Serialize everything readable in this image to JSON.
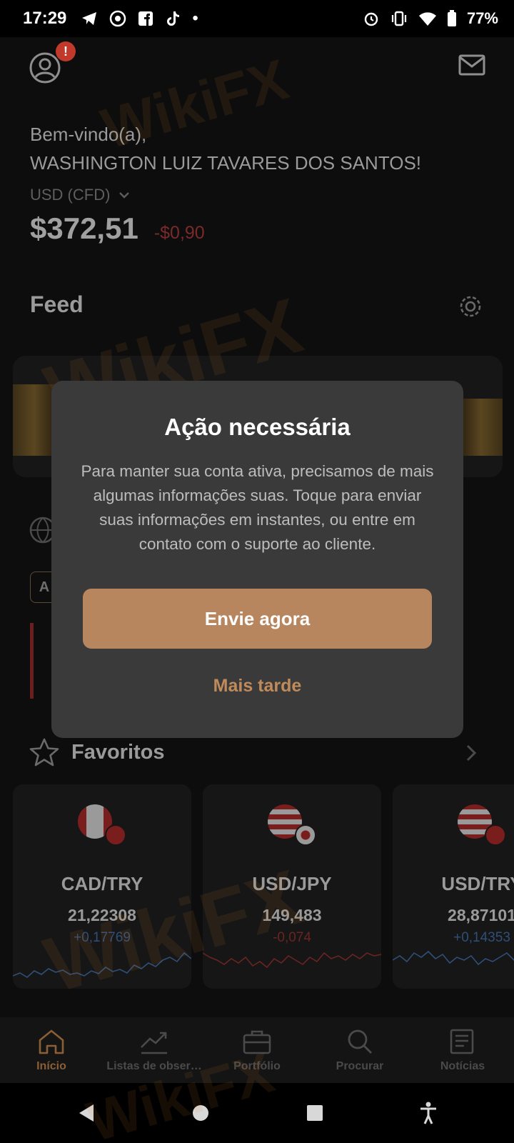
{
  "status_bar": {
    "time": "17:29",
    "battery": "77%"
  },
  "header": {
    "alert_badge": "!",
    "welcome_line1": "Bem-vindo(a),",
    "welcome_line2": "WASHINGTON LUIZ TAVARES DOS SANTOS!",
    "currency": "USD (CFD)",
    "balance": "$372,51",
    "balance_change": "-$0,90"
  },
  "feed": {
    "title": "Feed",
    "chip_letter": "A"
  },
  "favorites": {
    "title": "Favoritos",
    "items": [
      {
        "pair": "CAD/TRY",
        "price": "21,22308",
        "change": "+0,17769",
        "direction": "up"
      },
      {
        "pair": "USD/JPY",
        "price": "149,483",
        "change": "-0,074",
        "direction": "down"
      },
      {
        "pair": "USD/TRY",
        "price": "28,87101",
        "change": "+0,14353",
        "direction": "up"
      }
    ]
  },
  "bottom_nav": [
    {
      "label": "Início",
      "icon": "home-icon",
      "active": true
    },
    {
      "label": "Listas de obser…",
      "icon": "chart-trend-icon",
      "active": false
    },
    {
      "label": "Portfólio",
      "icon": "briefcase-icon",
      "active": false
    },
    {
      "label": "Procurar",
      "icon": "search-icon",
      "active": false
    },
    {
      "label": "Notícias",
      "icon": "news-icon",
      "active": false
    }
  ],
  "dialog": {
    "title": "Ação necessária",
    "body": "Para manter sua conta ativa, precisamos de mais algumas informações suas. Toque para enviar suas informações em instantes, ou entre em contato com o suporte ao cliente.",
    "primary_label": "Envie agora",
    "secondary_label": "Mais tarde"
  },
  "watermark": "WikiFX",
  "colors": {
    "accent": "#b8865e",
    "negative": "#c0392b",
    "positive": "#3b6fb0",
    "dialog_bg": "#3a3a3a"
  }
}
